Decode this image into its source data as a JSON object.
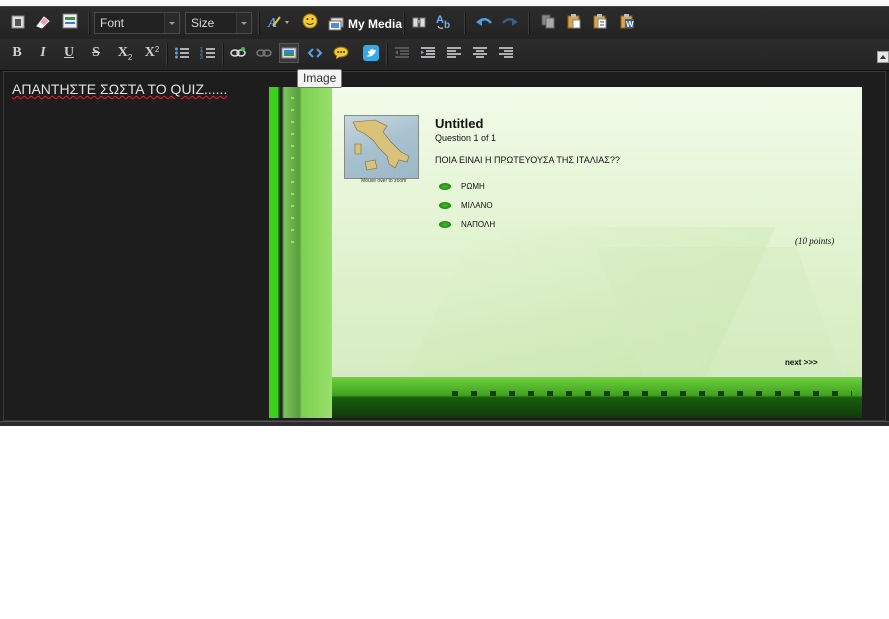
{
  "toolbar_row1": {
    "font_combo": "Font",
    "size_combo": "Size",
    "my_media": "My Media"
  },
  "toolbar_row2": {
    "bold": "B",
    "italic": "I",
    "underline": "U",
    "strike": "S",
    "subscript": "X",
    "superscript": "X"
  },
  "tooltip": "Image",
  "content": {
    "text": "ΑΠΑΝΤΗΣΤΕ ΣΩΣΤΑ ΤΟ QUIZ......"
  },
  "quiz_image": {
    "title": "Untitled",
    "question_number": "Question 1 of 1",
    "question": "ΠΟΙΑ ΕΙΝΑΙ Η ΠΡΩΤΕΥΟΥΣΑ ΤΗΣ ΙΤΑΛΙΑΣ??",
    "answers": [
      "ΡΩΜΗ",
      "ΜΙΛΑΝΟ",
      "ΝΑΠΟΛΗ"
    ],
    "points": "(10 points)",
    "next": "next >>>",
    "map_caption": "Mouse over to zoom"
  },
  "colors": {
    "editor_bg": "#1d1d1d",
    "toolbar_bg": "#2a2a2a",
    "accent_blue": "#4aa3df"
  }
}
